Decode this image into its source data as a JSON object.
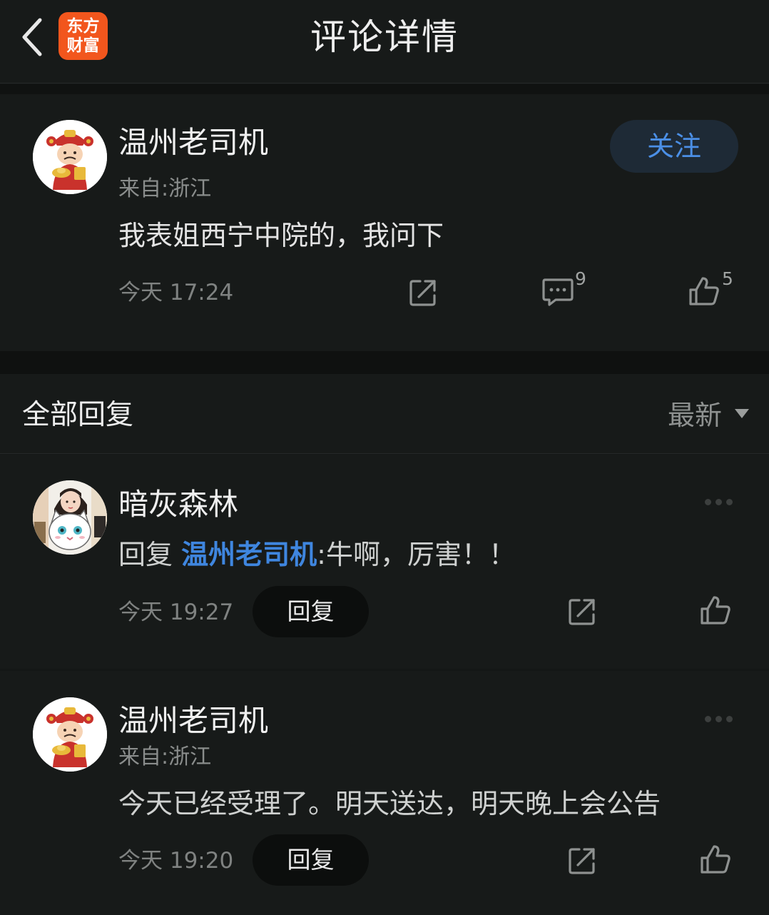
{
  "header": {
    "title": "评论详情",
    "logo_line1": "东方",
    "logo_line2": "财富",
    "logo_color": "#f2561d"
  },
  "main_comment": {
    "username": "温州老司机",
    "location": "来自:浙江",
    "content": "我表姐西宁中院的，我问下",
    "time": "今天 17:24",
    "follow_label": "关注",
    "comment_count": "9",
    "like_count": "5",
    "avatar": "god-of-wealth-avatar"
  },
  "replies_header": {
    "title": "全部回复",
    "sort_label": "最新"
  },
  "replies": [
    {
      "username": "暗灰森林",
      "reply_prefix": "回复",
      "mention": "温州老司机",
      "separator": ":",
      "content": "牛啊，厉害！！",
      "time": "今天 19:27",
      "reply_button": "回复",
      "avatar": "girl-and-cat-avatar"
    },
    {
      "username": "温州老司机",
      "location": "来自:浙江",
      "content": "今天已经受理了。明天送达，明天晚上会公告",
      "time": "今天 19:20",
      "reply_button": "回复",
      "avatar": "god-of-wealth-avatar"
    }
  ],
  "colors": {
    "background": "#141716",
    "card": "#171a19",
    "accent_blue": "#3f86df",
    "follow_bg": "#1e2a36"
  }
}
